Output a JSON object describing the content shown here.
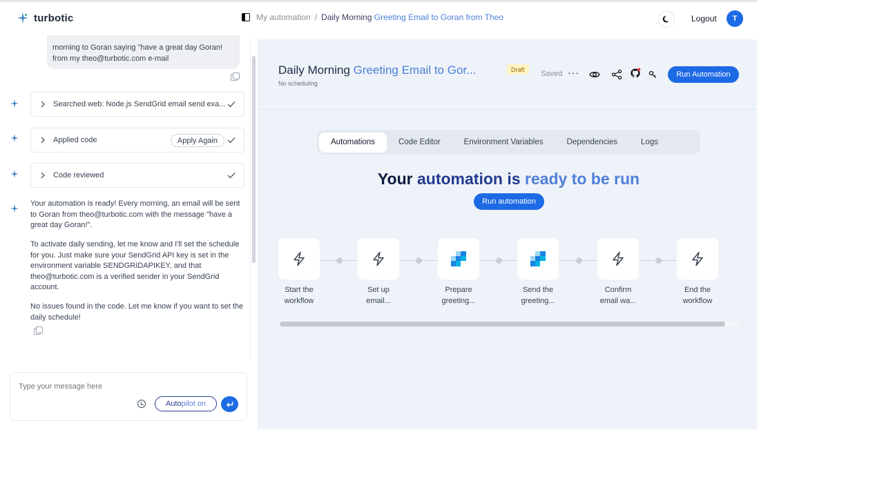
{
  "header": {
    "brand": "turbotic",
    "breadcrumb_root": "My automation",
    "breadcrumb_sep": "/",
    "breadcrumb_current_a": "Daily Morning ",
    "breadcrumb_current_b": "Greeting Email to Goran from Theo",
    "logout": "Logout",
    "avatar_initial": "T"
  },
  "chat": {
    "user_message_line1": "morning to Goran saying \"have a great day Goran!",
    "user_message_line2": "from my theo@turbotic.com e-mail",
    "steps": [
      {
        "label": "Searched web: Node.js SendGrid email send exa...",
        "action": ""
      },
      {
        "label": "Applied code",
        "action": "Apply Again"
      },
      {
        "label": "Code reviewed",
        "action": ""
      }
    ],
    "ai_paragraphs": [
      "Your automation is ready! Every morning, an email will be sent to Goran from theo@turbotic.com with the message \"have a great day Goran!\".",
      "To activate daily sending, let me know and I'll set the schedule for you. Just make sure your SendGrid API key is set in the environment variable SENDGRIDAPIKEY, and that theo@turbotic.com is a verified sender in your SendGrid account.",
      "No issues found in the code. Let me know if you want to set the daily schedule!"
    ],
    "composer_placeholder": "Type your message here",
    "autopilot_a": "Auto",
    "autopilot_b": "pilot on"
  },
  "automation": {
    "title_a": "Daily Morning ",
    "title_b": "Greeting Email to Gor...",
    "schedule": "No scheduling",
    "status_badge": "Draft",
    "saved": "Saved",
    "more": "···",
    "run_button": "Run Automation",
    "tabs": [
      "Automations",
      "Code Editor",
      "Environment Variables",
      "Dependencies",
      "Logs"
    ],
    "active_tab": "Automations",
    "ready_a": "Your ",
    "ready_b": "automation",
    "ready_c": " is ",
    "ready_d": "ready to be run",
    "run_automation": "Run automation",
    "flow_nodes": [
      {
        "line1": "Start the",
        "line2": "workflow",
        "icon": "lightning-icon"
      },
      {
        "line1": "Set up",
        "line2": "email...",
        "icon": "lightning-icon"
      },
      {
        "line1": "Prepare",
        "line2": "greeting...",
        "icon": "sendgrid-icon"
      },
      {
        "line1": "Send the",
        "line2": "greeting...",
        "icon": "sendgrid-icon"
      },
      {
        "line1": "Confirm",
        "line2": "email wa...",
        "icon": "lightning-icon"
      },
      {
        "line1": "End the",
        "line2": "workflow",
        "icon": "lightning-icon"
      }
    ]
  },
  "colors": {
    "accent": "#1d6ae5",
    "gradient_blue": "#4a7fd8",
    "main_bg": "#eef3f9",
    "draft_bg": "#fdf3c4"
  }
}
